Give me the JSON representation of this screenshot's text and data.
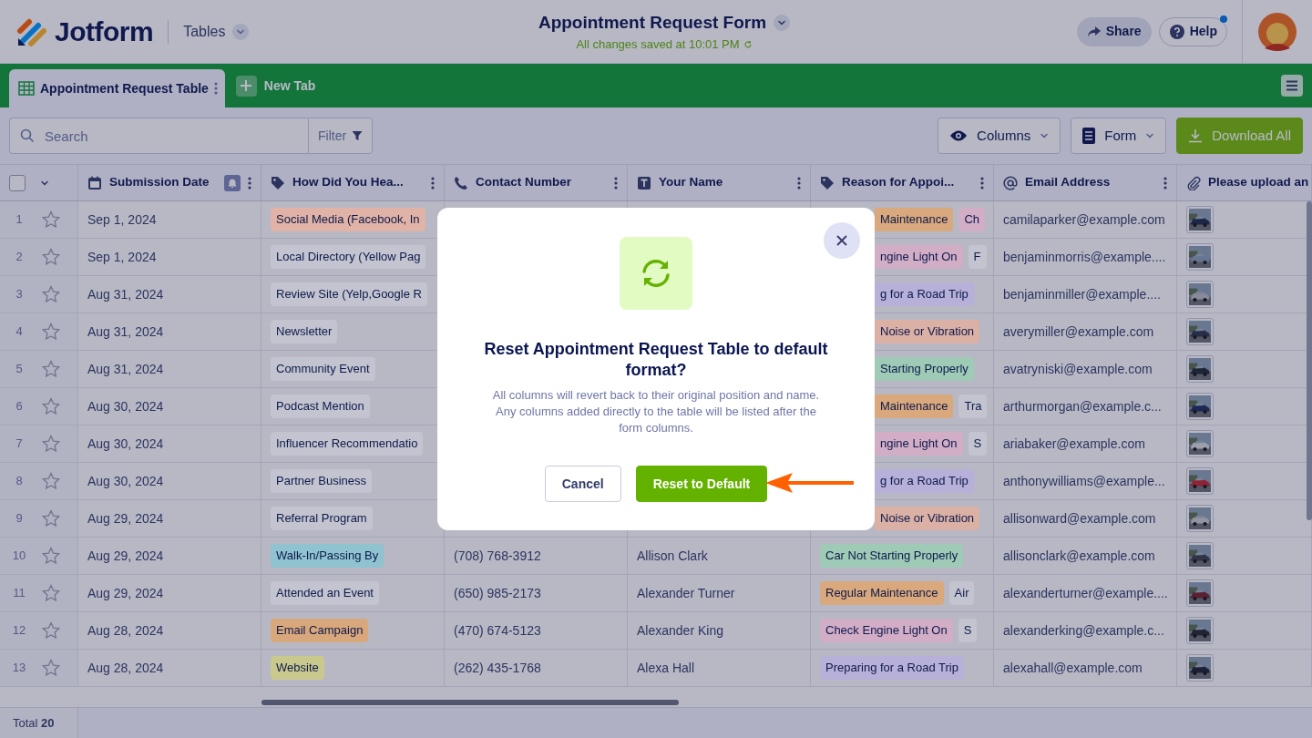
{
  "header": {
    "logo": "Jotform",
    "section": "Tables",
    "title": "Appointment Request Form",
    "save_status": "All changes saved at 10:01 PM"
  },
  "header_buttons": [
    {
      "label": "Share",
      "kind": "share"
    },
    {
      "label": "Help",
      "kind": "help",
      "notification": true
    }
  ],
  "tabs": [
    {
      "label": "Appointment Request Table",
      "selected": true
    }
  ],
  "new_tab_button": "New Tab",
  "search": {
    "placeholder": "Search"
  },
  "filter_button": "Filter",
  "toolbar_buttons": [
    {
      "label": "Columns",
      "kind": "columns"
    },
    {
      "label": "Form",
      "kind": "form"
    },
    {
      "label": "Download All",
      "kind": "download"
    }
  ],
  "table": {
    "select_all_checked": false,
    "columns": [
      {
        "label": "Submission Date",
        "kind": "date"
      },
      {
        "label": "How Did You Hea...",
        "kind": "tag"
      },
      {
        "label": "Contact Number",
        "kind": "phone"
      },
      {
        "label": "Your Name",
        "kind": "text"
      },
      {
        "label": "Reason for Appoi...",
        "kind": "tag"
      },
      {
        "label": "Email Address",
        "kind": "email"
      },
      {
        "label": "Please upload an",
        "kind": "upload"
      }
    ],
    "rows": [
      {
        "num": "1",
        "starred": false,
        "date": "Sep 1, 2024",
        "source": {
          "text": "Social Media (Facebook, In",
          "color": "#e0b3a6"
        },
        "reasons": [
          {
            "text": "Maintenance",
            "color": "#d9a87c",
            "clipped": true
          },
          {
            "text": "Ch",
            "color": "#d2adc6"
          }
        ],
        "email": "camilaparker@example.com",
        "attachment": {
          "kind": "picture"
        }
      },
      {
        "num": "2",
        "starred": false,
        "date": "Sep 1, 2024",
        "source": {
          "text": "Local Directory (Yellow Pag",
          "color": "#c3c4cf"
        },
        "reasons": [
          {
            "text": "ngine Light On",
            "color": "#d2adc6",
            "clipped": true
          },
          {
            "text": "F",
            "color": "#c3c4cf"
          }
        ],
        "email": "benjaminmorris@example....",
        "attachment": {
          "kind": "picture"
        }
      },
      {
        "num": "3",
        "starred": false,
        "date": "Aug 31, 2024",
        "source": {
          "text": "Review Site (Yelp,Google R",
          "color": "#c3c4cf"
        },
        "reasons": [
          {
            "text": "g for a Road Trip",
            "color": "#b7b0d9",
            "clipped": true
          }
        ],
        "email": "benjaminmiller@example....",
        "attachment": {
          "kind": "picture"
        }
      },
      {
        "num": "4",
        "starred": false,
        "date": "Aug 31, 2024",
        "source": {
          "text": "Newsletter",
          "color": "#c3c4cf"
        },
        "reasons": [
          {
            "text": "Noise or Vibration",
            "color": "#dbb0a5",
            "clipped": true
          }
        ],
        "email": "averymiller@example.com",
        "attachment": {
          "kind": "picture"
        }
      },
      {
        "num": "5",
        "starred": false,
        "date": "Aug 31, 2024",
        "source": {
          "text": "Community Event",
          "color": "#c3c4cf"
        },
        "reasons": [
          {
            "text": "Starting Properly",
            "color": "#9fcab6",
            "clipped": true
          }
        ],
        "email": "avatryniski@example.com",
        "attachment": {
          "kind": "picture"
        }
      },
      {
        "num": "6",
        "starred": false,
        "date": "Aug 30, 2024",
        "source": {
          "text": "Podcast Mention",
          "color": "#c3c4cf"
        },
        "reasons": [
          {
            "text": "Maintenance",
            "color": "#d9a87c",
            "clipped": true
          },
          {
            "text": "Tra",
            "color": "#c3c4cf"
          }
        ],
        "email": "arthurmorgan@example.c...",
        "attachment": {
          "kind": "picture"
        }
      },
      {
        "num": "7",
        "starred": false,
        "date": "Aug 30, 2024",
        "source": {
          "text": "Influencer Recommendatio",
          "color": "#c3c4cf"
        },
        "reasons": [
          {
            "text": "ngine Light On",
            "color": "#d2adc6",
            "clipped": true
          },
          {
            "text": "S",
            "color": "#c3c4cf"
          }
        ],
        "email": "ariabaker@example.com",
        "attachment": {
          "kind": "picture"
        }
      },
      {
        "num": "8",
        "starred": false,
        "date": "Aug 30, 2024",
        "source": {
          "text": "Partner Business",
          "color": "#c3c4cf"
        },
        "reasons": [
          {
            "text": "g for a Road Trip",
            "color": "#b7b0d9",
            "clipped": true
          }
        ],
        "email": "anthonywilliams@example...",
        "attachment": {
          "kind": "picture"
        }
      },
      {
        "num": "9",
        "starred": false,
        "date": "Aug 29, 2024",
        "source": {
          "text": "Referral Program",
          "color": "#c3c4cf"
        },
        "reasons": [
          {
            "text": "Noise or Vibration",
            "color": "#dbb0a5",
            "clipped": true
          }
        ],
        "email": "allisonward@example.com",
        "attachment": {
          "kind": "picture"
        }
      },
      {
        "num": "10",
        "starred": false,
        "date": "Aug 29, 2024",
        "source": {
          "text": "Walk-In/Passing By",
          "color": "#8fc3cf"
        },
        "contact": "(708) 768-3912",
        "name": "Allison Clark",
        "reasons": [
          {
            "text": "Car Not Starting Properly",
            "color": "#9fcab6"
          }
        ],
        "email": "allisonclark@example.com",
        "attachment": {
          "kind": "picture"
        }
      },
      {
        "num": "11",
        "starred": false,
        "date": "Aug 29, 2024",
        "source": {
          "text": "Attended an Event",
          "color": "#c3c4cf"
        },
        "contact": "(650) 985-2173",
        "name": "Alexander Turner",
        "reasons": [
          {
            "text": "Regular Maintenance",
            "color": "#d9a87c"
          },
          {
            "text": "Air",
            "color": "#c3c4cf"
          }
        ],
        "email": "alexanderturner@example....",
        "attachment": {
          "kind": "picture"
        }
      },
      {
        "num": "12",
        "starred": false,
        "date": "Aug 28, 2024",
        "source": {
          "text": "Email Campaign",
          "color": "#d9a77c"
        },
        "contact": "(470) 674-5123",
        "name": "Alexander King",
        "reasons": [
          {
            "text": "Check Engine Light On",
            "color": "#d2adc6"
          },
          {
            "text": "S",
            "color": "#c3c4cf"
          }
        ],
        "email": "alexanderking@example.c...",
        "attachment": {
          "kind": "picture"
        }
      },
      {
        "num": "13",
        "starred": false,
        "date": "Aug 28, 2024",
        "source": {
          "text": "Website",
          "color": "#c9c98e"
        },
        "contact": "(262) 435-1768",
        "name": "Alexa Hall",
        "reasons": [
          {
            "text": "Preparing for a Road Trip",
            "color": "#b7b0d9"
          }
        ],
        "email": "alexahall@example.com",
        "attachment": {
          "kind": "picture"
        }
      }
    ]
  },
  "footer": {
    "total": "Total **20**"
  },
  "dialog": {
    "title": "Reset Appointment Request Table to default format?",
    "message": "All columns will revert back to their original position and name. Any columns added directly to the table will be listed after the form columns.",
    "buttons": [
      {
        "label": "Cancel",
        "kind": "secondary"
      },
      {
        "label": "Reset to Default",
        "kind": "primary"
      }
    ],
    "arrow_to_primary": true
  }
}
